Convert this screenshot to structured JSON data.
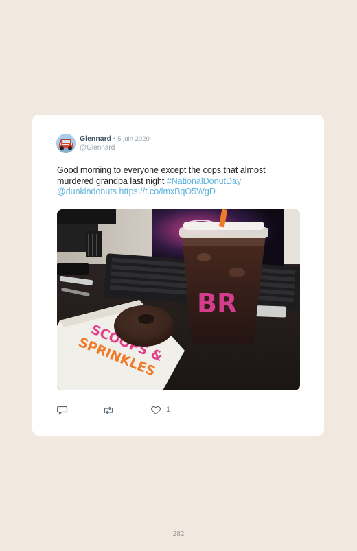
{
  "tweet": {
    "author_name": "Glennard",
    "separator": "•",
    "date": "5 juin 2020",
    "handle": "@Glennard",
    "text_plain": "Good morning to everyone except the cops that almost murdered grandpa last night ",
    "hashtag": "#NationalDonutDay",
    "mention": "@dunkindonuts",
    "url": "https://t.co/lmxBqO5WgD",
    "like_count": "1",
    "photo_texts": {
      "cup_logo": "BR",
      "napkin_line1": "SCOOPS &",
      "napkin_line2": "SPRINKLES"
    }
  },
  "icons": {
    "reply": "reply-icon",
    "retweet": "retweet-icon",
    "like": "heart-icon",
    "avatar": "red-car-avatar"
  },
  "colors": {
    "page_background": "#f1e8df",
    "card_background": "#ffffff",
    "link": "#5fb3dd",
    "author_name": "#3d5262",
    "meta_gray": "#9aa4ad"
  },
  "page_number": "282"
}
